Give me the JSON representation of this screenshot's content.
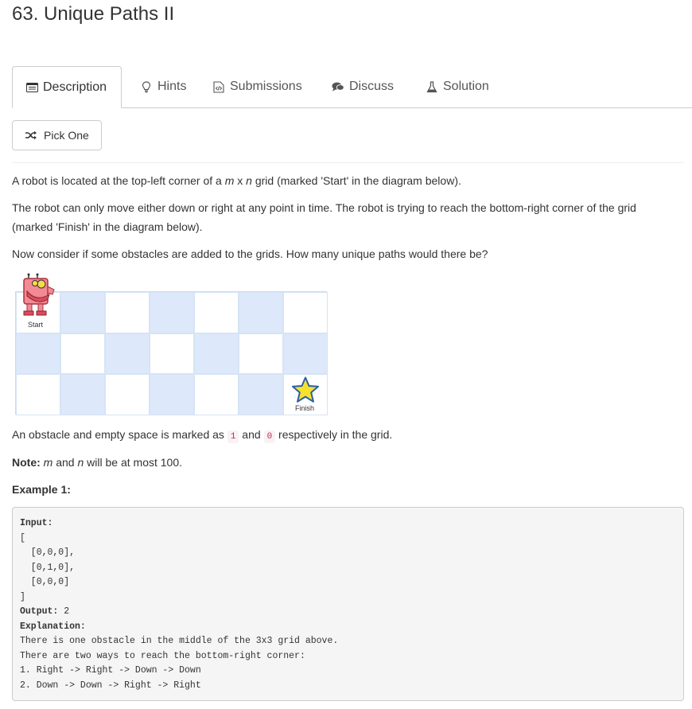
{
  "problem": {
    "title": "63. Unique Paths II"
  },
  "tabs": [
    {
      "label": "Description",
      "icon": "description-icon",
      "active": true
    },
    {
      "label": "Hints",
      "icon": "lightbulb-icon",
      "active": false
    },
    {
      "label": "Submissions",
      "icon": "code-file-icon",
      "active": false
    },
    {
      "label": "Discuss",
      "icon": "chat-bubbles-icon",
      "active": false
    },
    {
      "label": "Solution",
      "icon": "flask-icon",
      "active": false
    }
  ],
  "pick_one": {
    "label": "Pick One",
    "icon": "shuffle-icon"
  },
  "description": {
    "p1_a": "A robot is located at the top-left corner of a ",
    "p1_m": "m",
    "p1_x": " x ",
    "p1_n": "n",
    "p1_b": " grid (marked 'Start' in the diagram below).",
    "p2": "The robot can only move either down or right at any point in time. The robot is trying to reach the bottom-right corner of the grid (marked 'Finish' in the diagram below).",
    "p3": "Now consider if some obstacles are added to the grids. How many unique paths would there be?",
    "p4_a": "An obstacle and empty space is marked as ",
    "p4_code1": "1",
    "p4_and": " and ",
    "p4_code0": "0",
    "p4_b": " respectively in the grid.",
    "note_label": "Note:",
    "note_m": "m",
    "note_and": " and ",
    "note_n": "n",
    "note_rest": " will be at most 100.",
    "example_heading": "Example 1:"
  },
  "diagram": {
    "start_label": "Start",
    "finish_label": "Finish",
    "rows": 3,
    "cols": 7,
    "colors": {
      "shade": "#dde9fb",
      "plain": "#ffffff",
      "border": "#d6e4f5"
    }
  },
  "example": {
    "input_label": "Input:",
    "input_lines": [
      "[",
      "  [0,0,0],",
      "  [0,1,0],",
      "  [0,0,0]",
      "]"
    ],
    "output_label": "Output:",
    "output_value": " 2",
    "explanation_label": "Explanation:",
    "explanation_lines": [
      "There is one obstacle in the middle of the 3x3 grid above.",
      "There are two ways to reach the bottom-right corner:",
      "1. Right -> Right -> Down -> Down",
      "2. Down -> Down -> Right -> Right"
    ]
  }
}
